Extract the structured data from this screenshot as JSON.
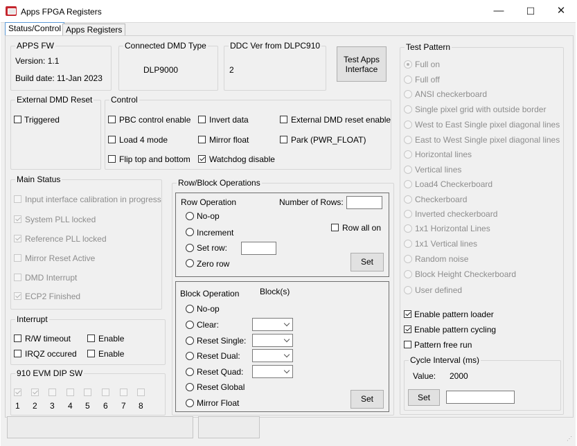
{
  "window": {
    "title": "Apps FPGA Registers",
    "minimize": "—",
    "maximize": "☐",
    "close": "✕",
    "icon_color": "#c4262e"
  },
  "tabs": [
    {
      "label": "Status/Control"
    },
    {
      "label": "Apps Registers"
    }
  ],
  "apps_fw": {
    "title": "APPS FW",
    "version": "Version: 1.1",
    "build_date": "Build date: 11-Jan 2023"
  },
  "connected_dmd": {
    "title": "Connected DMD Type",
    "value": "DLP9000"
  },
  "ddc_ver": {
    "title": "DDC Ver from DLPC910",
    "value": "2"
  },
  "test_apps_button": {
    "line1": "Test Apps",
    "line2": "Interface"
  },
  "external_dmd_reset": {
    "title": "External DMD Reset",
    "triggered": "Triggered"
  },
  "control": {
    "title": "Control",
    "pbc_control_enable": "PBC control enable",
    "invert_data": "Invert data",
    "external_dmd_reset_enable": "External DMD reset enable",
    "load4_mode": "Load 4 mode",
    "mirror_float": "Mirror float",
    "park": "Park (PWR_FLOAT)",
    "flip_top_bottom": "Flip top and bottom",
    "watchdog_disable": "Watchdog disable"
  },
  "main_status": {
    "title": "Main Status",
    "items": [
      {
        "label": "Input interface calibration in progress",
        "checked": false
      },
      {
        "label": "System PLL locked",
        "checked": true
      },
      {
        "label": "Reference PLL locked",
        "checked": true
      },
      {
        "label": "Mirror Reset Active",
        "checked": false
      },
      {
        "label": "DMD Interrupt",
        "checked": false
      },
      {
        "label": "ECP2 Finished",
        "checked": true
      }
    ]
  },
  "interrupt": {
    "title": "Interrupt",
    "rw_timeout": "R/W timeout",
    "irqz": "IRQZ occured",
    "enable1": "Enable",
    "enable2": "Enable"
  },
  "dip_sw": {
    "title": "910 EVM DIP SW",
    "switches": [
      {
        "label": "1",
        "checked": true
      },
      {
        "label": "2",
        "checked": true
      },
      {
        "label": "3",
        "checked": false
      },
      {
        "label": "4",
        "checked": false
      },
      {
        "label": "5",
        "checked": false
      },
      {
        "label": "6",
        "checked": false
      },
      {
        "label": "7",
        "checked": false
      },
      {
        "label": "8",
        "checked": false
      }
    ]
  },
  "row_block": {
    "title": "Row/Block Operations",
    "row_operation": "Row Operation",
    "number_of_rows": "Number of Rows:",
    "no_op": "No-op",
    "increment": "Increment",
    "set_row": "Set row:",
    "zero_row": "Zero row",
    "row_all_on": "Row all on",
    "set_button": "Set",
    "block_operation": "Block Operation",
    "blocks": "Block(s)",
    "block_no_op": "No-op",
    "clear": "Clear:",
    "reset_single": "Reset Single:",
    "reset_dual": "Reset Dual:",
    "reset_quad": "Reset Quad:",
    "reset_global": "Reset Global",
    "mirror_float": "Mirror Float",
    "block_set_button": "Set"
  },
  "test_pattern": {
    "title": "Test Pattern",
    "options": [
      {
        "label": "Full on",
        "selected": true
      },
      {
        "label": "Full off",
        "selected": false
      },
      {
        "label": "ANSI checkerboard",
        "selected": false
      },
      {
        "label": "Single pixel grid with outside border",
        "selected": false
      },
      {
        "label": "West to East Single pixel diagonal lines",
        "selected": false
      },
      {
        "label": "East to West Single pixel diagonal lines",
        "selected": false
      },
      {
        "label": "Horizontal lines",
        "selected": false
      },
      {
        "label": "Vertical lines",
        "selected": false
      },
      {
        "label": "Load4 Checkerboard",
        "selected": false
      },
      {
        "label": "Checkerboard",
        "selected": false
      },
      {
        "label": "Inverted checkerboard",
        "selected": false
      },
      {
        "label": "1x1 Horizontal Lines",
        "selected": false
      },
      {
        "label": "1x1 Vertical lines",
        "selected": false
      },
      {
        "label": "Random noise",
        "selected": false
      },
      {
        "label": "Block Height Checkerboard",
        "selected": false
      },
      {
        "label": "User defined",
        "selected": false
      }
    ],
    "enable_pattern_loader": "Enable pattern loader",
    "enable_pattern_cycling": "Enable pattern cycling",
    "pattern_free_run": "Pattern free run",
    "cycle_interval": {
      "title": "Cycle Interval (ms)",
      "value_label": "Value:",
      "value": "2000",
      "set_button": "Set"
    }
  }
}
